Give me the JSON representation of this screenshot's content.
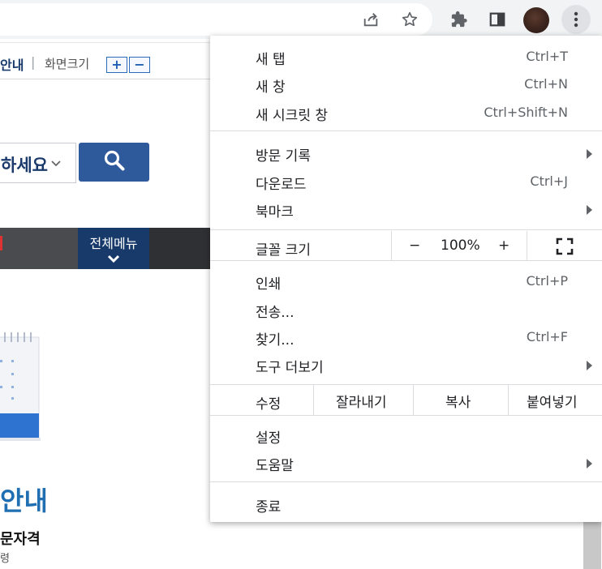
{
  "toolbar": {
    "icons": [
      "share-icon",
      "bookmark-star-icon",
      "extensions-puzzle-icon",
      "side-panel-icon",
      "profile-avatar",
      "more-vert-icon"
    ]
  },
  "page": {
    "util": {
      "guide": "안내",
      "separator": "|",
      "zoom_label": "화면크기",
      "zoom_in": "+",
      "zoom_out": "−"
    },
    "search": {
      "select_text": "하세요",
      "chevron": "⌄"
    },
    "gnb": {
      "all_menu": "전체메뉴"
    },
    "heading": "안내",
    "subheading": "문자격",
    "small": "령"
  },
  "menu": {
    "new_tab": {
      "label": "새 탭",
      "shortcut": "Ctrl+T"
    },
    "new_window": {
      "label": "새 창",
      "shortcut": "Ctrl+N"
    },
    "incognito": {
      "label": "새 시크릿 창",
      "shortcut": "Ctrl+Shift+N"
    },
    "history": {
      "label": "방문 기록"
    },
    "downloads": {
      "label": "다운로드",
      "shortcut": "Ctrl+J"
    },
    "bookmarks": {
      "label": "북마크"
    },
    "zoom": {
      "label": "글꼴 크기",
      "minus": "−",
      "value": "100%",
      "plus": "+"
    },
    "print": {
      "label": "인쇄",
      "shortcut": "Ctrl+P"
    },
    "cast": {
      "label": "전송..."
    },
    "find": {
      "label": "찾기...",
      "shortcut": "Ctrl+F"
    },
    "more_tools": {
      "label": "도구 더보기"
    },
    "edit": {
      "label": "수정",
      "cut": "잘라내기",
      "copy": "복사",
      "paste": "붙여넣기"
    },
    "settings": {
      "label": "설정"
    },
    "help": {
      "label": "도움말"
    },
    "exit": {
      "label": "종료"
    }
  },
  "colors": {
    "menu_bg": "#ffffff",
    "text": "#202124",
    "shortcut": "#5f6368",
    "accent_blue": "#2e5a9c"
  }
}
